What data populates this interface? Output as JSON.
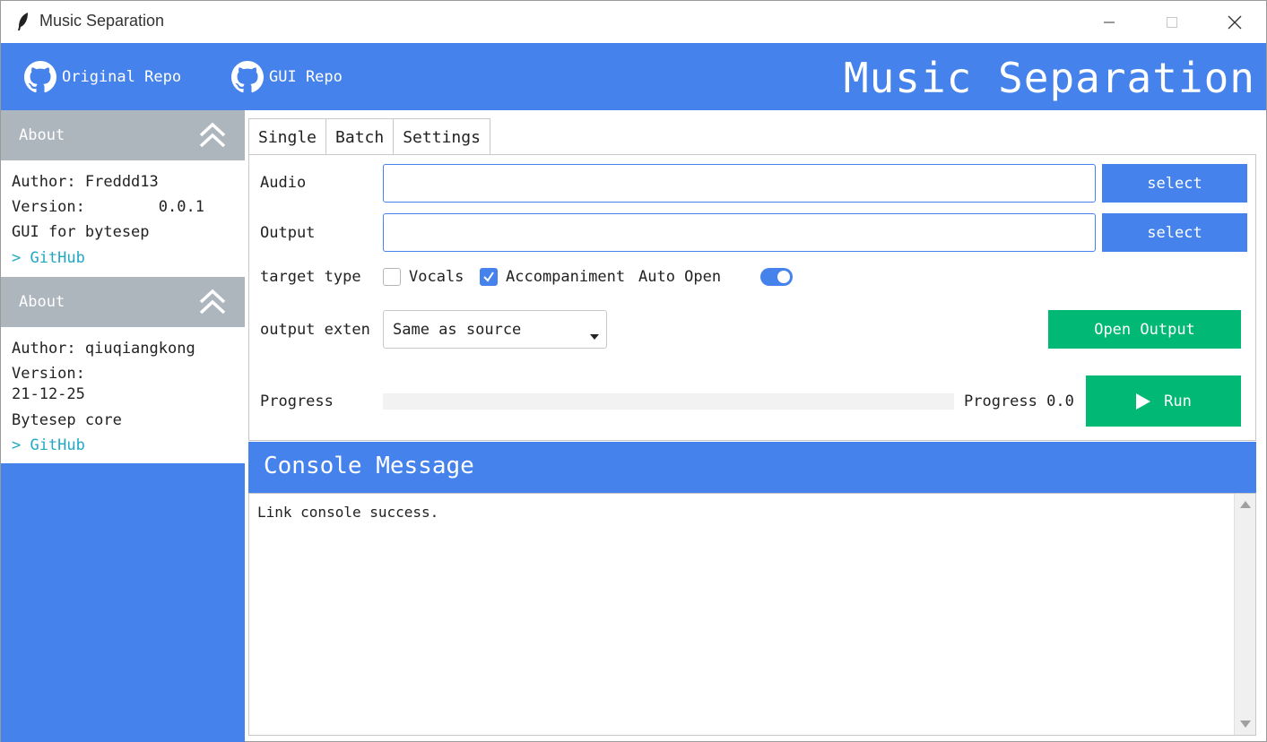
{
  "window": {
    "title": "Music Separation"
  },
  "header": {
    "links": [
      {
        "label": "Original Repo",
        "icon": "github-icon"
      },
      {
        "label": "GUI Repo",
        "icon": "github-icon"
      }
    ],
    "heading": "Music Separation"
  },
  "sidebar": {
    "sections": [
      {
        "title": "About",
        "lines": [
          "Author: Freddd13",
          "Version:        0.0.1",
          "GUI for bytesep"
        ],
        "link": "> GitHub"
      },
      {
        "title": "About",
        "lines": [
          "Author: qiuqiangkong",
          "Version:",
          "21-12-25",
          "Bytesep core"
        ],
        "link": "> GitHub"
      }
    ]
  },
  "tabs": [
    {
      "label": "Single",
      "active": true
    },
    {
      "label": "Batch",
      "active": false
    },
    {
      "label": "Settings",
      "active": false
    }
  ],
  "form": {
    "audio_label": "Audio",
    "audio_value": "",
    "output_label": "Output",
    "output_value": "",
    "select_label": "select",
    "target_type_label": "target type",
    "vocals_label": "Vocals",
    "vocals_checked": false,
    "accompaniment_label": "Accompaniment",
    "accompaniment_checked": true,
    "auto_open_label": "Auto Open",
    "auto_open_on": true,
    "output_exten_label": "output exten",
    "output_exten_value": "Same as source",
    "open_output_label": "Open Output",
    "progress_label": "Progress",
    "progress_value": 0.0,
    "progress_text": "Progress 0.0",
    "run_label": "Run"
  },
  "console": {
    "title": "Console Message",
    "text": "Link console success."
  },
  "colors": {
    "primary": "#4582ec",
    "success": "#02b875",
    "secondary": "#adb5bd",
    "link": "#20a8c5"
  }
}
